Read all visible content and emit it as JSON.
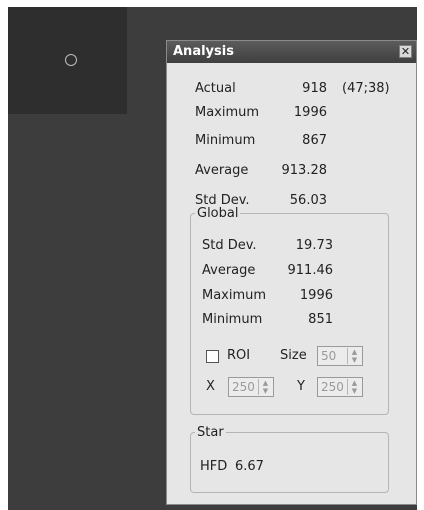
{
  "panel": {
    "title": "Analysis",
    "close_glyph": "✕",
    "stats": {
      "actual_label": "Actual",
      "actual_value": "918",
      "actual_pos": "(47;38)",
      "maximum_label": "Maximum",
      "maximum_value": "1996",
      "minimum_label": "Minimum",
      "minimum_value": "867",
      "average_label": "Average",
      "average_value": "913.28",
      "stddev_label": "Std Dev.",
      "stddev_value": "56.03"
    },
    "global": {
      "legend": "Global",
      "stddev_label": "Std Dev.",
      "stddev_value": "19.73",
      "average_label": "Average",
      "average_value": "911.46",
      "maximum_label": "Maximum",
      "maximum_value": "1996",
      "minimum_label": "Minimum",
      "minimum_value": "851",
      "roi_label": "ROI",
      "roi_checked": false,
      "size_label": "Size",
      "size_value": "50",
      "x_label": "X",
      "x_value": "250",
      "y_label": "Y",
      "y_value": "250"
    },
    "star": {
      "legend": "Star",
      "hfd_label": "HFD",
      "hfd_value": "6.67"
    }
  }
}
